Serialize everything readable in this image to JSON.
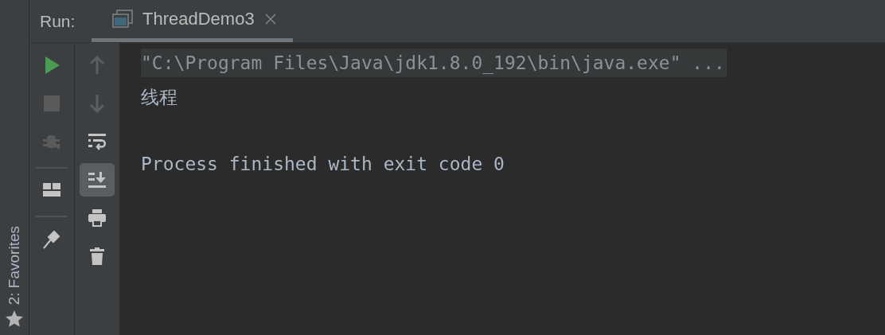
{
  "side_stripe": {
    "label": "2: Favorites"
  },
  "header": {
    "label": "Run:",
    "tabs": [
      {
        "title": "ThreadDemo3",
        "selected": true
      }
    ]
  },
  "toolbar_left": [
    {
      "kind": "run",
      "disabled": false
    },
    {
      "kind": "stop",
      "disabled": true
    },
    {
      "kind": "debug",
      "disabled": true
    },
    {
      "kind": "separator"
    },
    {
      "kind": "layout",
      "disabled": false
    },
    {
      "kind": "separator"
    },
    {
      "kind": "pin",
      "disabled": false
    }
  ],
  "toolbar_right": [
    {
      "kind": "up",
      "disabled": true,
      "selected": false
    },
    {
      "kind": "down",
      "disabled": true,
      "selected": false
    },
    {
      "kind": "wrap",
      "disabled": false,
      "selected": false
    },
    {
      "kind": "scroll_end",
      "disabled": false,
      "selected": true
    },
    {
      "kind": "print",
      "disabled": false,
      "selected": false
    },
    {
      "kind": "trash",
      "disabled": false,
      "selected": false
    }
  ],
  "console": {
    "lines": [
      {
        "kind": "command",
        "text": "\"C:\\Program Files\\Java\\jdk1.8.0_192\\bin\\java.exe\" ..."
      },
      {
        "kind": "output",
        "text": "线程"
      },
      {
        "kind": "blank"
      },
      {
        "kind": "output",
        "text": "Process finished with exit code 0"
      }
    ]
  }
}
